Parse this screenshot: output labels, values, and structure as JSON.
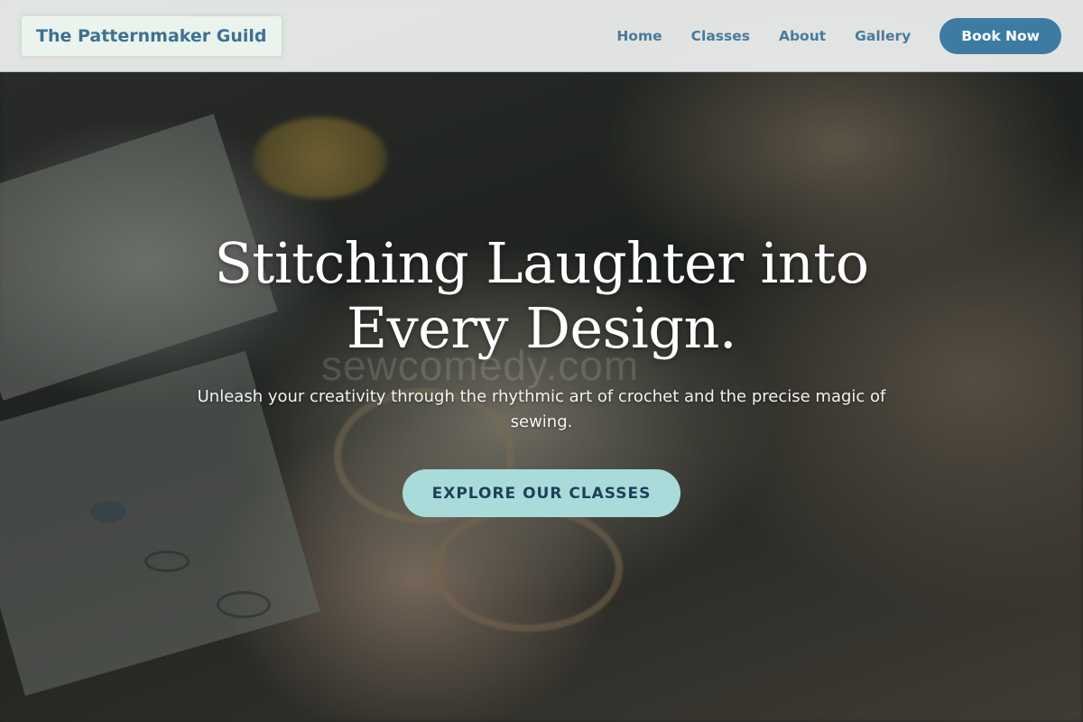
{
  "header": {
    "brand": "The Patternmaker Guild",
    "nav": [
      {
        "label": "Home"
      },
      {
        "label": "Classes"
      },
      {
        "label": "About"
      },
      {
        "label": "Gallery"
      }
    ],
    "book_button": "Book Now"
  },
  "hero": {
    "title_line_1": "Stitching Laughter into",
    "title_line_2": "Every Design.",
    "subtitle_line_1": "Unleash your creativity through the rhythmic art of crochet and the precise magic of",
    "subtitle_line_2": "sewing.",
    "cta_label": "EXPLORE OUR CLASSES",
    "watermark": "sewcomedy.com"
  },
  "colors": {
    "brand_text": "#3f7095",
    "nav_text": "#4a7a9c",
    "book_button_bg": "#3d7ba3",
    "cta_bg": "#a9dbdb",
    "cta_text": "#1e3f5a"
  }
}
